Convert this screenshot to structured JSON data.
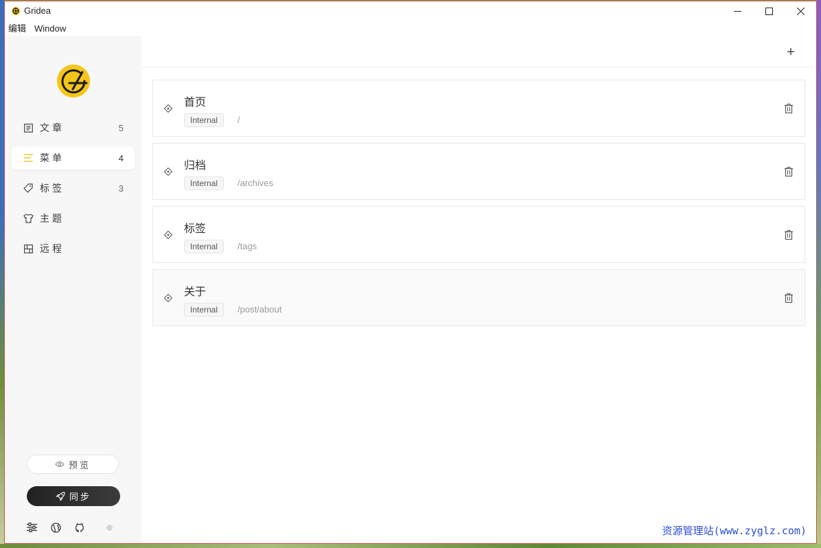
{
  "window": {
    "title": "Gridea",
    "controls": {
      "minimize": "–",
      "maximize": "☐",
      "close": "✕"
    }
  },
  "menubar": [
    "编辑",
    "Window"
  ],
  "sidebar": {
    "logo": "gridea-logo",
    "items": [
      {
        "label": "文章",
        "count": "5",
        "icon": "document-icon",
        "active": false
      },
      {
        "label": "菜单",
        "count": "4",
        "icon": "menu-icon",
        "active": true
      },
      {
        "label": "标签",
        "count": "3",
        "icon": "tag-icon",
        "active": false
      },
      {
        "label": "主题",
        "count": "",
        "icon": "tshirt-icon",
        "active": false
      },
      {
        "label": "远程",
        "count": "",
        "icon": "server-icon",
        "active": false
      }
    ],
    "preview_label": "预览",
    "sync_label": "同步",
    "footer_icons": [
      "settings-icon",
      "globe-icon",
      "github-icon"
    ]
  },
  "main": {
    "add_label": "+",
    "menus": [
      {
        "name": "首页",
        "type": "Internal",
        "link": "/"
      },
      {
        "name": "归档",
        "type": "Internal",
        "link": "/archives"
      },
      {
        "name": "标签",
        "type": "Internal",
        "link": "/tags"
      },
      {
        "name": "关于",
        "type": "Internal",
        "link": "/post/about"
      }
    ]
  },
  "watermark": "资源管理站(www.zyglz.com)",
  "colors": {
    "accent": "#f5c518",
    "sidebar_bg": "#f7f7f7",
    "sync_button": "#2b2b2b",
    "watermark": "#2a4fd0"
  }
}
